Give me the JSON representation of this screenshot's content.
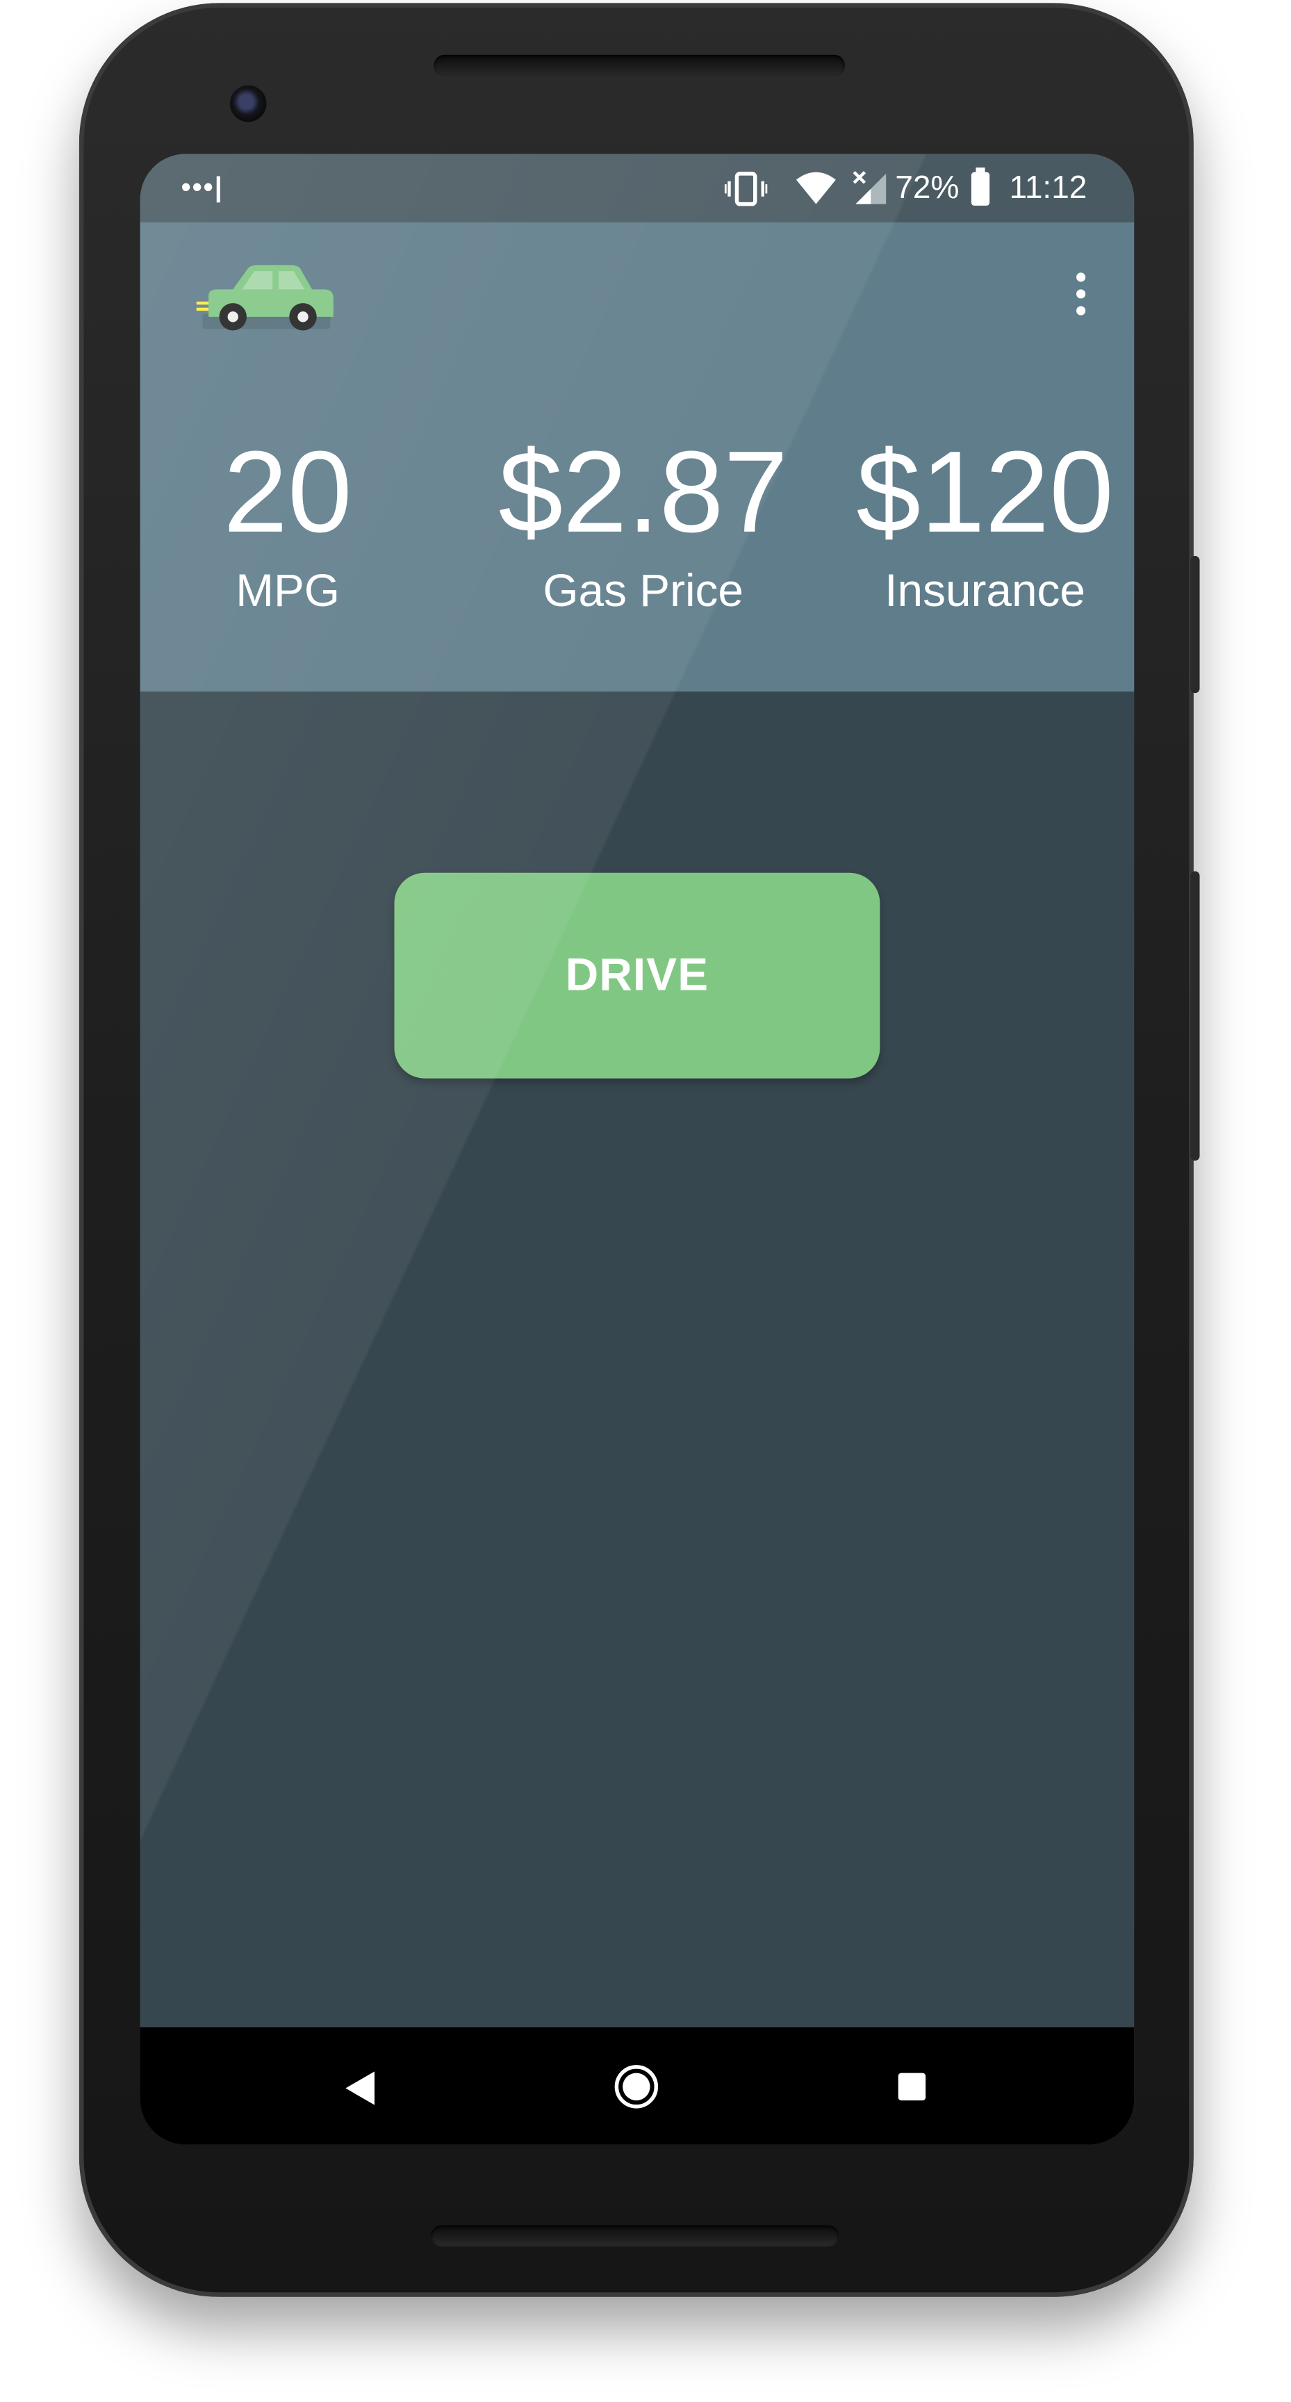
{
  "status_bar": {
    "carrier_indicator": "•••|",
    "battery_percent": "72%",
    "time": "11:12",
    "icons": [
      "vibrate-icon",
      "wifi-icon",
      "cell-signal-icon",
      "battery-icon"
    ]
  },
  "app_bar": {
    "logo_icon": "car-icon",
    "menu_icon": "overflow-menu-icon"
  },
  "stats": {
    "mpg": {
      "value": "20",
      "label": "MPG"
    },
    "gas_price": {
      "value": "$2.87",
      "label": "Gas Price"
    },
    "insurance": {
      "value": "$120",
      "label": "Insurance"
    }
  },
  "actions": {
    "drive_label": "DRIVE"
  },
  "nav_bar": {
    "icons": [
      "back-icon",
      "home-icon",
      "recents-icon"
    ]
  },
  "colors": {
    "header": "#607d8b",
    "background": "#37474f",
    "status_bar": "#4a5a62",
    "accent": "#81c784",
    "nav_bar": "#000000"
  }
}
